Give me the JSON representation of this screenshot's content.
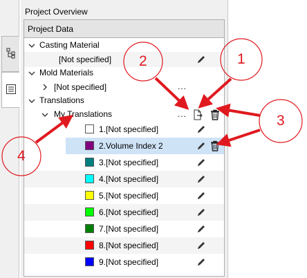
{
  "panel": {
    "title": "Project Overview",
    "frame_header": "Project Data"
  },
  "tree": {
    "casting_material": {
      "label": "Casting Material",
      "child": "[Not specified]"
    },
    "mold_materials": {
      "label": "Mold Materials",
      "child": "[Not specified]",
      "child_dots": "..."
    },
    "translations": {
      "label": "Translations",
      "group": {
        "label": "My Translations",
        "dots": "..."
      },
      "items": [
        {
          "label": "1.[Not specified]",
          "color": "#ffffff"
        },
        {
          "label": "2.Volume Index 2",
          "color": "#800080"
        },
        {
          "label": "3.[Not specified]",
          "color": "#008080"
        },
        {
          "label": "4.[Not specified]",
          "color": "#00ffff"
        },
        {
          "label": "5.[Not specified]",
          "color": "#ffff00"
        },
        {
          "label": "6.[Not specified]",
          "color": "#00ff00"
        },
        {
          "label": "7.[Not specified]",
          "color": "#008000"
        },
        {
          "label": "8.[Not specified]",
          "color": "#ff0000"
        },
        {
          "label": "9.[Not specified]",
          "color": "#0000ff"
        }
      ]
    }
  },
  "annotations": {
    "one": "1",
    "two": "2",
    "three": "3",
    "four": "4",
    "color": "#e0191f"
  },
  "icons": {
    "tab1": "tree-structure-icon",
    "tab2": "checklist-icon",
    "edit": "pencil-icon",
    "delete": "trash-icon",
    "export": "document-export-icon"
  }
}
